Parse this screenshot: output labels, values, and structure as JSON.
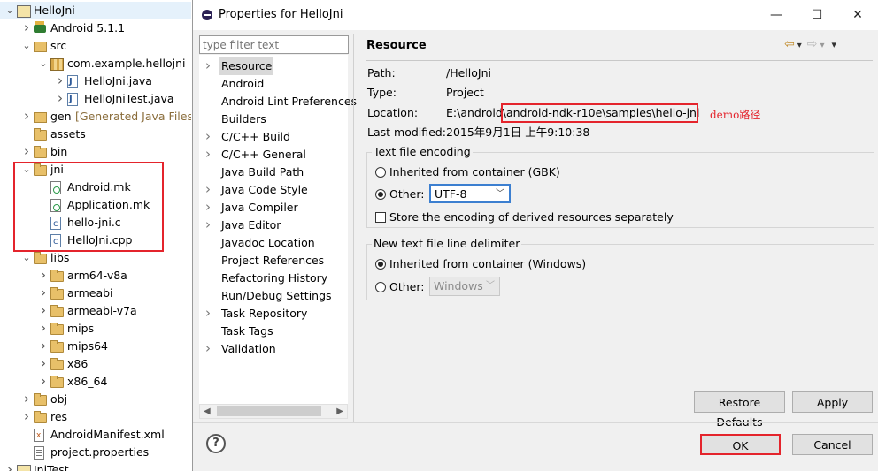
{
  "tree": {
    "items": [
      {
        "label": "HelloJni",
        "icon": "project-icon",
        "depth": 0,
        "twisty": "open"
      },
      {
        "label": "Android 5.1.1",
        "icon": "android-library-icon",
        "depth": 1,
        "twisty": "closed"
      },
      {
        "label": "src",
        "icon": "source-folder-icon",
        "depth": 1,
        "twisty": "open"
      },
      {
        "label": "com.example.hellojni",
        "icon": "package-icon",
        "depth": 2,
        "twisty": "open"
      },
      {
        "label": "HelloJni.java",
        "icon": "java-file-icon",
        "depth": 3,
        "twisty": "closed"
      },
      {
        "label": "HelloJniTest.java",
        "icon": "java-file-icon",
        "depth": 3,
        "twisty": "closed"
      },
      {
        "label": "gen",
        "decoration": "[Generated Java Files]",
        "icon": "gen-folder-icon",
        "depth": 1,
        "twisty": "closed"
      },
      {
        "label": "assets",
        "icon": "folder-icon",
        "depth": 1,
        "twisty": "none"
      },
      {
        "label": "bin",
        "icon": "folder-icon",
        "depth": 1,
        "twisty": "closed"
      },
      {
        "label": "jni",
        "icon": "folder-icon",
        "depth": 1,
        "twisty": "open"
      },
      {
        "label": "Android.mk",
        "icon": "makefile-icon",
        "depth": 2,
        "twisty": "none"
      },
      {
        "label": "Application.mk",
        "icon": "makefile-icon",
        "depth": 2,
        "twisty": "none"
      },
      {
        "label": "hello-jni.c",
        "icon": "c-file-icon",
        "depth": 2,
        "twisty": "none"
      },
      {
        "label": "HelloJni.cpp",
        "icon": "c-file-icon",
        "depth": 2,
        "twisty": "none"
      },
      {
        "label": "libs",
        "icon": "folder-icon",
        "depth": 1,
        "twisty": "open"
      },
      {
        "label": "arm64-v8a",
        "icon": "folder-icon",
        "depth": 2,
        "twisty": "closed"
      },
      {
        "label": "armeabi",
        "icon": "folder-icon",
        "depth": 2,
        "twisty": "closed"
      },
      {
        "label": "armeabi-v7a",
        "icon": "folder-icon",
        "depth": 2,
        "twisty": "closed"
      },
      {
        "label": "mips",
        "icon": "folder-icon",
        "depth": 2,
        "twisty": "closed"
      },
      {
        "label": "mips64",
        "icon": "folder-icon",
        "depth": 2,
        "twisty": "closed"
      },
      {
        "label": "x86",
        "icon": "folder-icon",
        "depth": 2,
        "twisty": "closed"
      },
      {
        "label": "x86_64",
        "icon": "folder-icon",
        "depth": 2,
        "twisty": "closed"
      },
      {
        "label": "obj",
        "icon": "folder-icon",
        "depth": 1,
        "twisty": "closed"
      },
      {
        "label": "res",
        "icon": "folder-icon",
        "depth": 1,
        "twisty": "closed"
      },
      {
        "label": "AndroidManifest.xml",
        "icon": "xml-file-icon",
        "depth": 1,
        "twisty": "none"
      },
      {
        "label": "project.properties",
        "icon": "properties-file-icon",
        "depth": 1,
        "twisty": "none"
      },
      {
        "label": "JniTest",
        "icon": "project-icon",
        "depth": 0,
        "twisty": "closed"
      }
    ]
  },
  "dialog": {
    "title": "Properties for HelloJni",
    "minimize_glyph": "—",
    "maximize_glyph": "☐",
    "close_glyph": "✕",
    "filter_placeholder": "type filter text",
    "pages": [
      {
        "label": "Resource",
        "twisty": "closed",
        "selected": true
      },
      {
        "label": "Android",
        "twisty": "none"
      },
      {
        "label": "Android Lint Preferences",
        "twisty": "none"
      },
      {
        "label": "Builders",
        "twisty": "none"
      },
      {
        "label": "C/C++ Build",
        "twisty": "closed"
      },
      {
        "label": "C/C++ General",
        "twisty": "closed"
      },
      {
        "label": "Java Build Path",
        "twisty": "none"
      },
      {
        "label": "Java Code Style",
        "twisty": "closed"
      },
      {
        "label": "Java Compiler",
        "twisty": "closed"
      },
      {
        "label": "Java Editor",
        "twisty": "closed"
      },
      {
        "label": "Javadoc Location",
        "twisty": "none"
      },
      {
        "label": "Project References",
        "twisty": "none"
      },
      {
        "label": "Refactoring History",
        "twisty": "none"
      },
      {
        "label": "Run/Debug Settings",
        "twisty": "none"
      },
      {
        "label": "Task Repository",
        "twisty": "closed"
      },
      {
        "label": "Task Tags",
        "twisty": "none"
      },
      {
        "label": "Validation",
        "twisty": "closed"
      }
    ],
    "page_title": "Resource",
    "nav": {
      "back": "⇦",
      "back_menu": "▾",
      "forward": "⇨",
      "forward_menu": "▾",
      "view_menu": "▾"
    },
    "props": {
      "path_label": "Path:",
      "path_value": "/HelloJni",
      "type_label": "Type:",
      "type_value": "Project",
      "location_label": "Location:",
      "location_prefix": "E:\\android\\",
      "location_highlight": "android-ndk-r10e\\samples\\hello-jni",
      "modified_label": "Last modified:",
      "modified_value": "2015年9月1日 上午9:10:38"
    },
    "annotation_note": "demo路径",
    "encoding": {
      "group_title": "Text file encoding",
      "inherited_label": "Inherited from container (GBK)",
      "other_label": "Other:",
      "other_value": "UTF-8",
      "selected": "other",
      "store_label": "Store the encoding of derived resources separately",
      "store_checked": false
    },
    "delimiter": {
      "group_title": "New text file line delimiter",
      "inherited_label": "Inherited from container (Windows)",
      "other_label": "Other:",
      "other_value": "Windows",
      "selected": "inherited"
    },
    "buttons": {
      "restore": "Restore Defaults",
      "apply": "Apply",
      "ok": "OK",
      "cancel": "Cancel",
      "help": "?"
    },
    "colors": {
      "annotation_red": "#e4242c",
      "focus_blue": "#3c7fd0"
    }
  }
}
